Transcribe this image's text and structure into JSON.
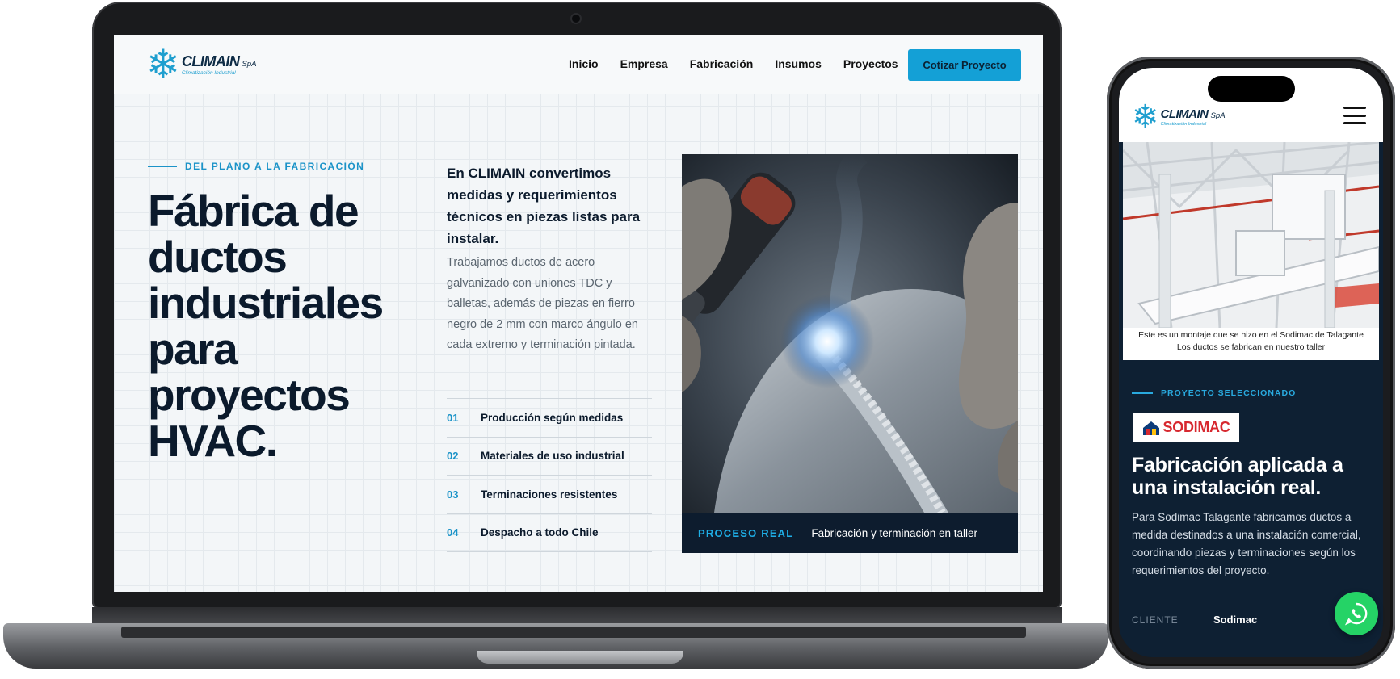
{
  "laptop": {
    "logo": {
      "brand": "CLIMAIN",
      "suffix": "SpA",
      "tagline": "Climatización Industrial"
    },
    "nav": [
      "Inicio",
      "Empresa",
      "Fabricación",
      "Insumos",
      "Proyectos"
    ],
    "cta_label": "Cotizar Proyecto",
    "eyebrow": "DEL PLANO A LA FABRICACIÓN",
    "headline": "Fábrica de ductos industriales para proyectos HVAC.",
    "lead": "En CLIMAIN convertimos medidas y requerimientos técnicos en piezas listas para instalar.",
    "body": "Trabajamos ductos de acero galvanizado con uniones TDC y balletas, además de piezas en fierro negro de 2 mm con marco ángulo en cada extremo y terminación pintada.",
    "features": [
      {
        "num": "01",
        "label": "Producción según medidas"
      },
      {
        "num": "02",
        "label": "Materiales de uso industrial"
      },
      {
        "num": "03",
        "label": "Terminaciones resistentes"
      },
      {
        "num": "04",
        "label": "Despacho a todo Chile"
      }
    ],
    "photo_caption": {
      "label": "PROCESO REAL",
      "text": "Fabricación y terminación en taller"
    }
  },
  "phone": {
    "logo": {
      "brand": "CLIMAIN",
      "suffix": "SpA",
      "tagline": "Climatización Industrial"
    },
    "photo_caption_line1": "Este es un montaje que se hizo en el Sodimac de Talagante",
    "photo_caption_line2": "Los ductos se fabrican en nuestro taller",
    "eyebrow": "PROYECTO SELECCIONADO",
    "client_logo_text": "SODIMAC",
    "title": "Fabricación aplicada a una instalación real.",
    "body": "Para Sodimac Talagante fabricamos ductos a medida destinados a una instalación comercial, coordinando piezas y terminaciones según los requerimientos del proyecto.",
    "client_key": "CLIENTE",
    "client_value": "Sodimac"
  },
  "colors": {
    "accent": "#14a0d6",
    "navy": "#0b1a2c",
    "whatsapp": "#25d366",
    "sodimac_red": "#d7282f"
  }
}
